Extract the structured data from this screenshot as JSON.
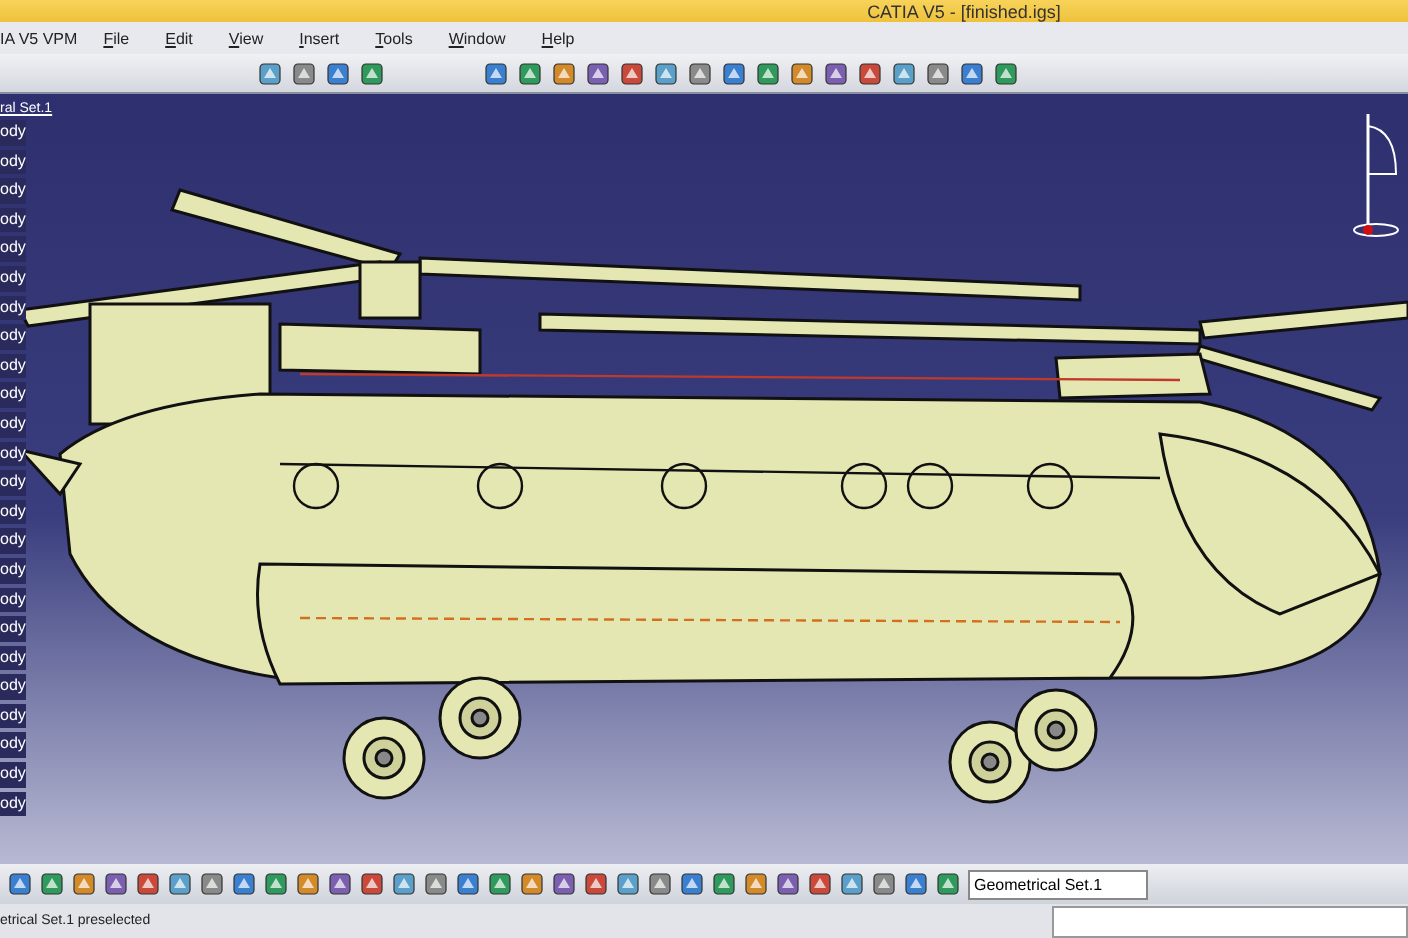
{
  "window": {
    "title": "CATIA V5 - [finished.igs]"
  },
  "app_label": "IA V5 VPM",
  "menu": [
    "File",
    "Edit",
    "View",
    "Insert",
    "Tools",
    "Window",
    "Help"
  ],
  "tree": {
    "root": "ral Set.1",
    "items": [
      "ody",
      "ody",
      "ody",
      "ody",
      "ody",
      "ody",
      "ody",
      "ody",
      "ody",
      "ody",
      "ody",
      "ody",
      "ody",
      "ody",
      "ody",
      "ody",
      "ody",
      "ody",
      "ody",
      "ody",
      "ody",
      "ody",
      "ody",
      "ody"
    ]
  },
  "set_selector": {
    "value": "Geometrical Set.1"
  },
  "status_bar": {
    "text": "etrical Set.1 preselected"
  }
}
